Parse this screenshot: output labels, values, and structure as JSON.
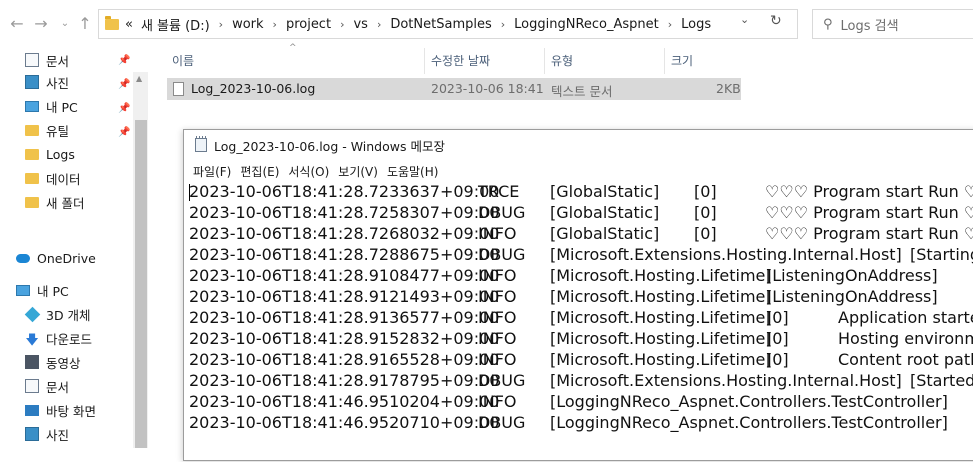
{
  "explorer": {
    "path_prefix": "«",
    "breadcrumbs": [
      "새 볼륨 (D:)",
      "work",
      "project",
      "vs",
      "DotNetSamples",
      "LoggingNReco_Aspnet",
      "Logs"
    ],
    "search_placeholder": "Logs 검색",
    "sidebar": {
      "quick_access": [
        {
          "label": "문서",
          "icon": "document-icon",
          "pinned": true
        },
        {
          "label": "사진",
          "icon": "pictures-icon",
          "pinned": true
        },
        {
          "label": "내 PC",
          "icon": "pc-icon",
          "pinned": true
        },
        {
          "label": "유틸",
          "icon": "folder-icon",
          "pinned": true
        },
        {
          "label": "Logs",
          "icon": "folder-icon",
          "pinned": false
        },
        {
          "label": "데이터",
          "icon": "folder-icon",
          "pinned": false
        },
        {
          "label": "새 폴더",
          "icon": "folder-icon",
          "pinned": false
        }
      ],
      "onedrive": "OneDrive",
      "this_pc": "내 PC",
      "this_pc_items": [
        {
          "label": "3D 개체",
          "icon": "3d-objects-icon"
        },
        {
          "label": "다운로드",
          "icon": "downloads-icon"
        },
        {
          "label": "동영상",
          "icon": "videos-icon"
        },
        {
          "label": "문서",
          "icon": "document-icon"
        },
        {
          "label": "바탕 화면",
          "icon": "desktop-icon"
        },
        {
          "label": "사진",
          "icon": "pictures-icon"
        }
      ]
    },
    "columns": {
      "name": "이름",
      "modified": "수정한 날짜",
      "type": "유형",
      "size": "크기"
    },
    "files": [
      {
        "name": "Log_2023-10-06.log",
        "modified": "2023-10-06 18:41",
        "type": "텍스트 문서",
        "size": "2KB"
      }
    ]
  },
  "notepad": {
    "title": "Log_2023-10-06.log - Windows 메모장",
    "menu": [
      "파일(F)",
      "편집(E)",
      "서식(O)",
      "보기(V)",
      "도움말(H)"
    ],
    "lines": [
      {
        "ts": "2023-10-06T18:41:28.7233637+09:00",
        "level": "TRCE",
        "cat": "[GlobalStatic]",
        "ev": "[0]",
        "msg": "♡♡♡ Program start Run ♡"
      },
      {
        "ts": "2023-10-06T18:41:28.7258307+09:00",
        "level": "DBUG",
        "cat": "[GlobalStatic]",
        "ev": "[0]",
        "msg": "♡♡♡ Program start Run ♡"
      },
      {
        "ts": "2023-10-06T18:41:28.7268032+09:00",
        "level": "INFO",
        "cat": "[GlobalStatic]",
        "ev": "[0]",
        "msg": "♡♡♡ Program start Run ♡"
      },
      {
        "ts": "2023-10-06T18:41:28.7288675+09:00",
        "level": "DBUG",
        "cat": "[Microsoft.Extensions.Hosting.Internal.Host]",
        "ev": "",
        "msg": "[Starting]"
      },
      {
        "ts": "2023-10-06T18:41:28.9108477+09:00",
        "level": "INFO",
        "cat": "[Microsoft.Hosting.Lifetime]",
        "ev": "[ListeningOnAddress]",
        "msg": ""
      },
      {
        "ts": "2023-10-06T18:41:28.9121493+09:00",
        "level": "INFO",
        "cat": "[Microsoft.Hosting.Lifetime]",
        "ev": "[ListeningOnAddress]",
        "msg": ""
      },
      {
        "ts": "2023-10-06T18:41:28.9136577+09:00",
        "level": "INFO",
        "cat": "[Microsoft.Hosting.Lifetime]",
        "ev": "[0]",
        "msg": "Application started"
      },
      {
        "ts": "2023-10-06T18:41:28.9152832+09:00",
        "level": "INFO",
        "cat": "[Microsoft.Hosting.Lifetime]",
        "ev": "[0]",
        "msg": "Hosting environment"
      },
      {
        "ts": "2023-10-06T18:41:28.9165528+09:00",
        "level": "INFO",
        "cat": "[Microsoft.Hosting.Lifetime]",
        "ev": "[0]",
        "msg": "Content root path"
      },
      {
        "ts": "2023-10-06T18:41:28.9178795+09:00",
        "level": "DBUG",
        "cat": "[Microsoft.Extensions.Hosting.Internal.Host]",
        "ev": "",
        "msg": "[Started]"
      },
      {
        "ts": "2023-10-06T18:41:46.9510204+09:00",
        "level": "INFO",
        "cat": "[LoggingNReco_Aspnet.Controllers.TestController]",
        "ev": "",
        "msg": ""
      },
      {
        "ts": "2023-10-06T18:41:46.9520710+09:00",
        "level": "DBUG",
        "cat": "[LoggingNReco_Aspnet.Controllers.TestController]",
        "ev": "",
        "msg": ""
      }
    ]
  }
}
